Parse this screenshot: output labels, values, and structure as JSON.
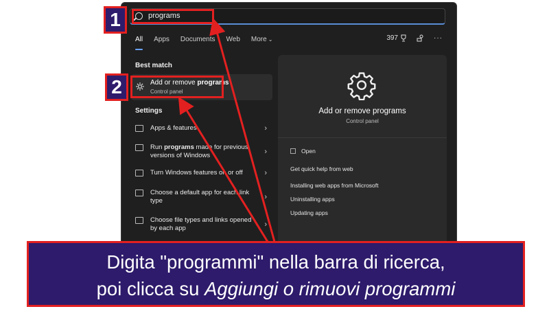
{
  "search": {
    "query": "programs"
  },
  "tabs": [
    {
      "label": "All"
    },
    {
      "label": "Apps"
    },
    {
      "label": "Documents"
    },
    {
      "label": "Web"
    },
    {
      "label": "More"
    }
  ],
  "toolbar": {
    "points": "397"
  },
  "best_match": {
    "heading": "Best match",
    "title_prefix": "Add or remove ",
    "title_bold": "programs",
    "subtitle": "Control panel"
  },
  "settings": {
    "heading": "Settings",
    "items": [
      {
        "before": "Apps & features",
        "bold": "",
        "after": ""
      },
      {
        "before": "Run ",
        "bold": "programs",
        "after": " made for previous versions of Windows"
      },
      {
        "before": "Turn Windows features on or off",
        "bold": "",
        "after": ""
      },
      {
        "before": "Choose a default app for each link type",
        "bold": "",
        "after": ""
      },
      {
        "before": "Choose file types and links opened by each app",
        "bold": "",
        "after": ""
      }
    ]
  },
  "detail": {
    "title": "Add or remove programs",
    "subtitle": "Control panel",
    "open": "Open",
    "web_heading": "Get quick help from web",
    "links": [
      "Installing web apps from Microsoft",
      "Uninstalling apps",
      "Updating apps"
    ]
  },
  "markers": {
    "one": "1",
    "two": "2"
  },
  "caption": {
    "line1": "Digita \"programmi\" nella barra di ricerca,",
    "line2_prefix": "poi clicca su ",
    "line2_italic": "Aggiungi o rimuovi programmi"
  },
  "colors": {
    "accent_red": "#e32020",
    "callout_purple": "#2e1b6b",
    "panel_dark": "#1f1f1f"
  }
}
